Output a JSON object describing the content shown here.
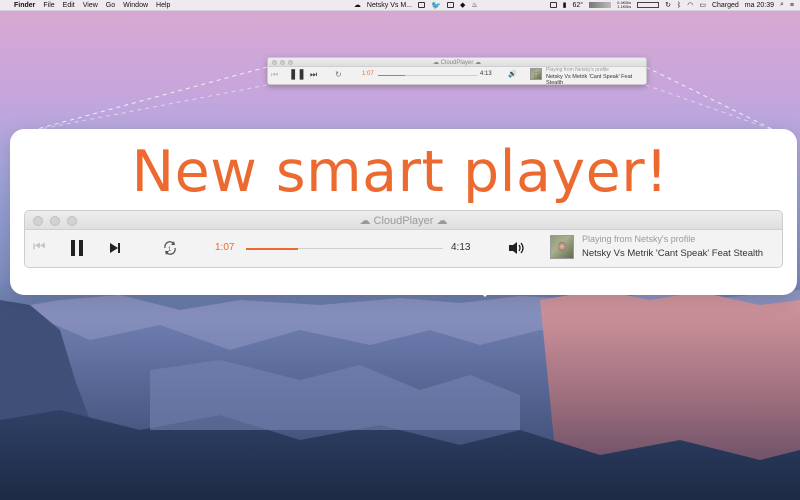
{
  "menubar": {
    "apple": "",
    "items": [
      "Finder",
      "File",
      "Edit",
      "View",
      "Go",
      "Window",
      "Help"
    ],
    "now_playing": "Netsky Vs M...",
    "net_up": "0.4KB/s",
    "net_down": "1.1KB/s",
    "temperature": "62°",
    "battery_status": "Charged",
    "clock": "ma 20:39"
  },
  "small_player": {
    "window_title": "CloudPlayer",
    "current_time": "1:07",
    "total_time": "4:13",
    "progress_fraction": 0.265,
    "source_text": "Playing from Netsky's profile",
    "track_title": "Netsky Vs Metrik 'Cant Speak' Feat Stealth"
  },
  "headline": "New smart player!",
  "big_player": {
    "window_title": "CloudPlayer",
    "current_time": "1:07",
    "total_time": "4:13",
    "progress_fraction": 0.265,
    "source_text": "Playing from Netsky's profile",
    "track_title": "Netsky Vs Metrik 'Cant Speak' Feat Stealth"
  },
  "icons": {
    "cloud": "cloud-icon",
    "prev": "previous-icon",
    "pause": "pause-icon",
    "next": "next-icon",
    "repeat": "repeat-one-icon",
    "volume": "volume-icon"
  },
  "colors": {
    "accent": "#ec6a30",
    "secondary_text": "#9a9a9a"
  }
}
